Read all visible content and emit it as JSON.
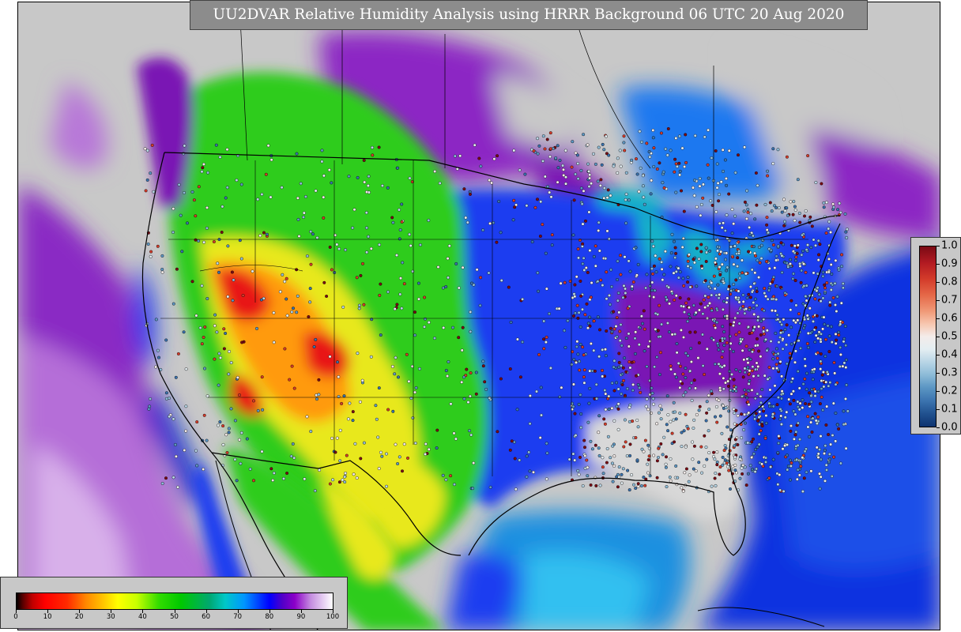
{
  "map": {
    "title": "UU2DVAR Relative Humidity Analysis using HRRR Background 06 UTC 20 Aug 2020",
    "colors": {
      "land_missing": "#c8c8c8",
      "ocean": "#0d2cd8",
      "ocean_cyan": "#1aa0e0",
      "purple": "#7a18b4",
      "magenta": "#b870d8",
      "blue": "#1a3cf0",
      "green": "#2ecc1a",
      "yellow": "#e8e81a",
      "orange": "#ff9a10",
      "red": "#e81414",
      "lake": "#12b0c8",
      "border": "#000000"
    }
  },
  "rh_colorbar": {
    "tick_labels": [
      "0",
      "10",
      "20",
      "30",
      "40",
      "50",
      "60",
      "70",
      "80",
      "90",
      "100"
    ],
    "min": 0,
    "max": 100
  },
  "obs_colorbar": {
    "tick_labels": [
      "1.0",
      "0.9",
      "0.8",
      "0.7",
      "0.6",
      "0.5",
      "0.4",
      "0.3",
      "0.2",
      "0.1",
      "0.0"
    ],
    "min": 0.0,
    "max": 1.0
  }
}
